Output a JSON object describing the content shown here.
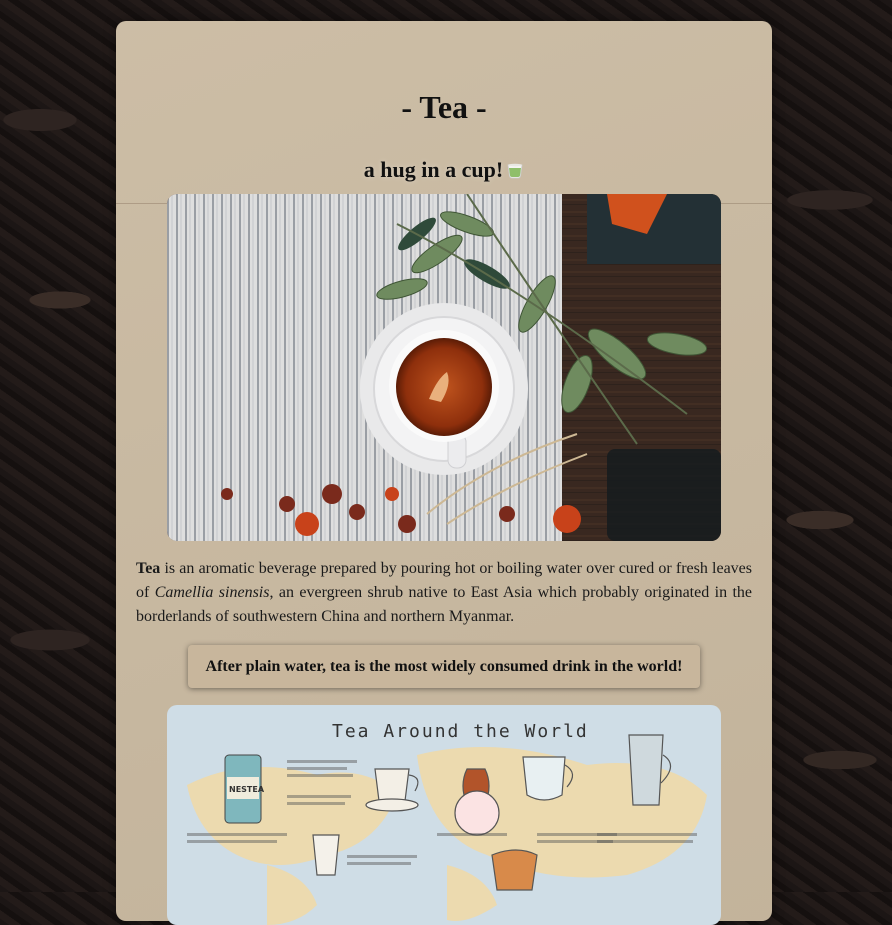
{
  "page": {
    "title": "- Tea -",
    "subtitle": "a hug in a cup!"
  },
  "hero_image": {
    "icon": "tea-cup-photo",
    "alt": "Cup of tea on striped cloth with tea leaves"
  },
  "intro": {
    "term": "Tea",
    "text_1": " is an aromatic beverage prepared by pouring hot or boiling water over cured or fresh leaves of ",
    "species": "Camellia sinensis",
    "text_2": ", an evergreen shrub native to East Asia which probably originated in the borderlands of southwestern China and northern Myanmar."
  },
  "callout": {
    "text": "After plain water, tea is the most widely consumed drink in the world!"
  },
  "map_image": {
    "title": "Tea Around the World",
    "tin_label": "NESTEA"
  },
  "colors": {
    "card": "#c9b9a0",
    "callout": "#c8b69c",
    "background": "#1a1413"
  }
}
